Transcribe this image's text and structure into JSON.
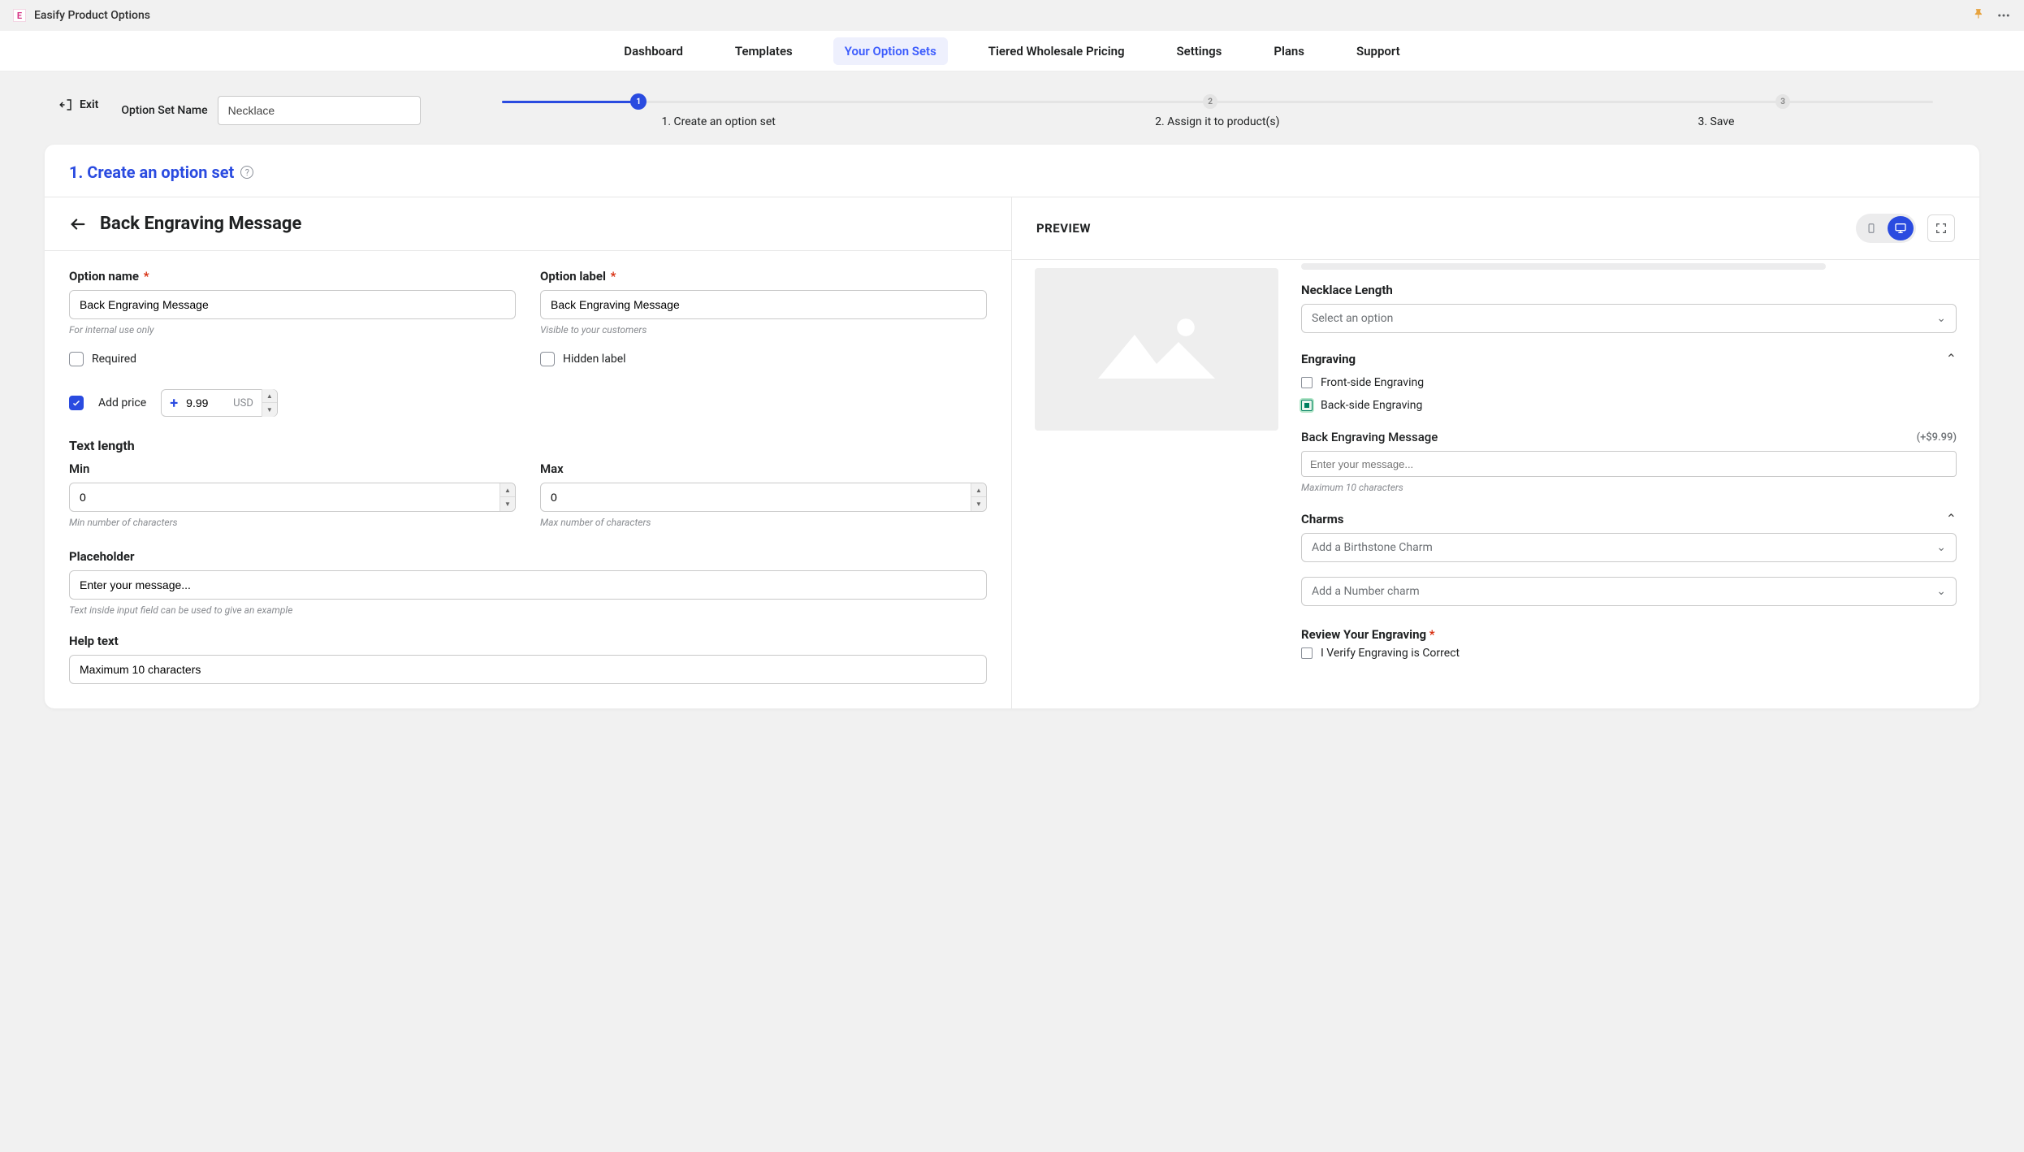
{
  "app": {
    "title": "Easify Product Options"
  },
  "nav": {
    "dashboard": "Dashboard",
    "templates": "Templates",
    "your_option_sets": "Your Option Sets",
    "tiered": "Tiered Wholesale Pricing",
    "settings": "Settings",
    "plans": "Plans",
    "support": "Support"
  },
  "exit": "Exit",
  "option_set_name_label": "Option Set Name",
  "option_set_name_value": "Necklace",
  "steps": {
    "s1": "1. Create an option set",
    "s2": "2. Assign it to product(s)",
    "s3": "3. Save",
    "n1": "1",
    "n2": "2",
    "n3": "3"
  },
  "panel_title": "1. Create an option set",
  "sub_title": "Back Engraving Message",
  "form": {
    "option_name_label": "Option name",
    "option_name_value": "Back Engraving Message",
    "option_name_hint": "For internal use only",
    "option_label_label": "Option label",
    "option_label_value": "Back Engraving Message",
    "option_label_hint": "Visible to your customers",
    "required_label": "Required",
    "hidden_label": "Hidden label",
    "add_price_label": "Add price",
    "price_value": "9.99",
    "price_currency": "USD",
    "text_length_label": "Text length",
    "min_label": "Min",
    "min_value": "0",
    "min_hint": "Min number of characters",
    "max_label": "Max",
    "max_value": "0",
    "max_hint": "Max number of characters",
    "placeholder_label": "Placeholder",
    "placeholder_value": "Enter your message...",
    "placeholder_hint": "Text inside input field can be used to give an example",
    "help_text_label": "Help text",
    "help_text_value": "Maximum 10 characters"
  },
  "preview": {
    "title": "PREVIEW",
    "necklace_length_label": "Necklace Length",
    "select_option": "Select an option",
    "engraving_label": "Engraving",
    "front_engraving": "Front-side Engraving",
    "back_engraving": "Back-side Engraving",
    "back_msg_label": "Back Engraving Message",
    "back_msg_price": "(+$9.99)",
    "back_msg_placeholder": "Enter your message...",
    "back_msg_hint": "Maximum 10 characters",
    "charms_label": "Charms",
    "birthstone_ph": "Add a Birthstone Charm",
    "number_charm_ph": "Add a Number charm",
    "review_label": "Review Your Engraving",
    "verify_label": "I Verify Engraving is Correct"
  }
}
